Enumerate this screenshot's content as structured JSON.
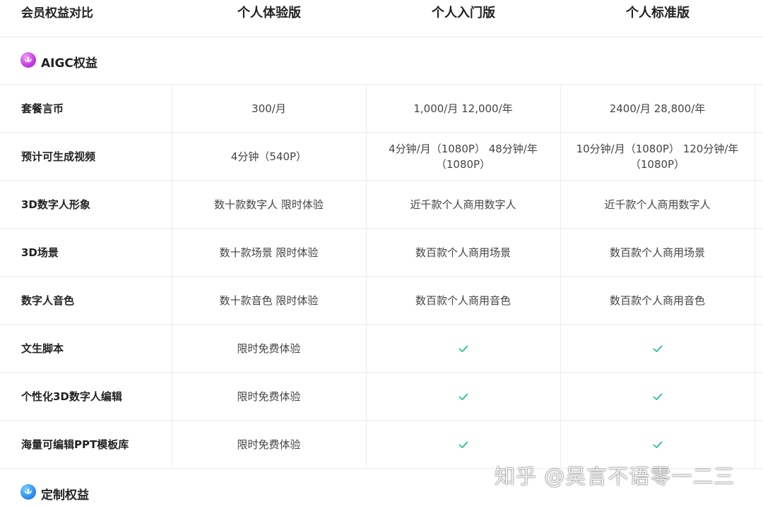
{
  "header": {
    "col0": "会员权益对比",
    "col1": "个人体验版",
    "col2": "个人入门版",
    "col3": "个人标准版"
  },
  "sections": {
    "aigc": {
      "title": "AIGC权益",
      "icon": "lotus-icon",
      "color": "#c33be0"
    },
    "custom": {
      "title": "定制权益",
      "icon": "lotus-icon",
      "color": "#2a8df0"
    }
  },
  "rows": [
    {
      "label": "套餐言币",
      "c1": "300/月",
      "c2": "1,000/月   12,000/年",
      "c3": "2400/月   28,800/年"
    },
    {
      "label": "预计可生成视频",
      "c1": "4分钟（540P）",
      "c2": "4分钟/月（1080P）   48分钟/年（1080P）",
      "c3": "10分钟/月（1080P）   120分钟/年（1080P）"
    },
    {
      "label": "3D数字人形象",
      "c1": "数十款数字人 限时体验",
      "c2": "近千款个人商用数字人",
      "c3": "近千款个人商用数字人"
    },
    {
      "label": "3D场景",
      "c1": "数十款场景 限时体验",
      "c2": "数百款个人商用场景",
      "c3": "数百款个人商用场景"
    },
    {
      "label": "数字人音色",
      "c1": "数十款音色 限时体验",
      "c2": "数百款个人商用音色",
      "c3": "数百款个人商用音色"
    },
    {
      "label": "文生脚本",
      "c1": "限时免费体验",
      "c2": "check-icon",
      "c3": "check-icon"
    },
    {
      "label": "个性化3D数字人编辑",
      "c1": "限时免费体验",
      "c2": "check-icon",
      "c3": "check-icon"
    },
    {
      "label": "海量可编辑PPT模板库",
      "c1": "限时免费体验",
      "c2": "check-icon",
      "c3": "check-icon"
    }
  ],
  "check_color": "#1fbf9a",
  "watermark": "知乎 @吴言不语零一二三"
}
